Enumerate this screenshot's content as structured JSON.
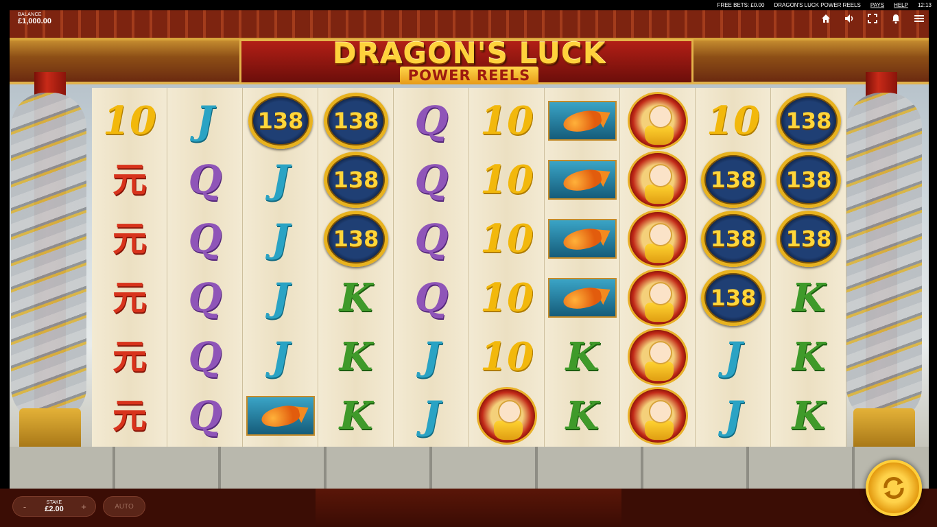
{
  "topbar": {
    "free_bets": "FREE BETS: £0.00",
    "game_name": "DRAGON'S LUCK POWER REELS",
    "pays": "PAYS",
    "help": "HELP",
    "clock": "12:13"
  },
  "balance": {
    "label": "BALANCE",
    "value": "£1,000.00"
  },
  "logo": {
    "line1": "DRAGON'S LUCK",
    "line2": "POWER REELS"
  },
  "hud": {
    "icons": [
      "home-icon",
      "sound-icon",
      "fullscreen-icon",
      "notification-bell-icon",
      "menu-icon"
    ]
  },
  "reels": [
    [
      "10",
      "A",
      "A",
      "A",
      "A",
      "A"
    ],
    [
      "J",
      "Q",
      "Q",
      "Q",
      "Q",
      "Q"
    ],
    [
      "138",
      "J",
      "J",
      "J",
      "J",
      "KOI"
    ],
    [
      "138",
      "138",
      "138",
      "K",
      "K",
      "K"
    ],
    [
      "Q",
      "Q",
      "Q",
      "Q",
      "J",
      "J"
    ],
    [
      "10",
      "10",
      "10",
      "10",
      "10",
      "WARRIOR"
    ],
    [
      "KOI",
      "KOI",
      "KOI",
      "KOI",
      "K",
      "K"
    ],
    [
      "WARRIOR",
      "WARRIOR",
      "WARRIOR",
      "WARRIOR",
      "WARRIOR",
      "WARRIOR"
    ],
    [
      "10",
      "138",
      "138",
      "138",
      "J",
      "J"
    ],
    [
      "138",
      "138",
      "138",
      "K",
      "K",
      "K"
    ]
  ],
  "symbol_glyphs": {
    "10": "10",
    "J": "J",
    "Q": "Q",
    "K": "K",
    "A": "元",
    "138": "138"
  },
  "controls": {
    "minus": "-",
    "plus": "+",
    "stake_label": "STAKE",
    "stake_value": "£2.00",
    "auto": "AUTO"
  },
  "colors": {
    "accent_gold": "#ffd23c",
    "panel_red": "#b21f16"
  }
}
